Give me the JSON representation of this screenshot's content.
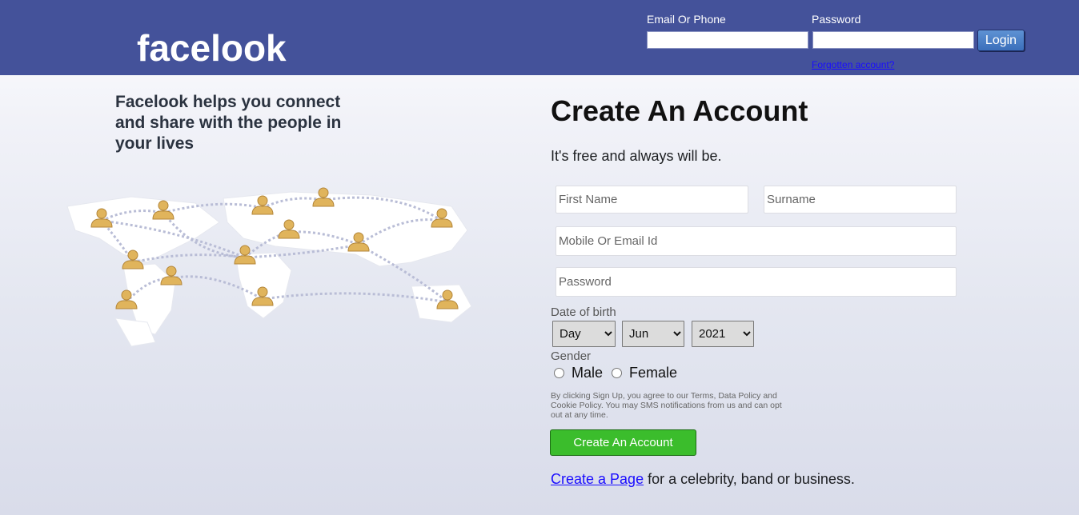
{
  "header": {
    "logo": "facelook",
    "email_label": "Email Or Phone",
    "password_label": "Password",
    "login_button": "Login",
    "forgot_link": "Forgotten account?"
  },
  "intro": {
    "tagline": "Facelook helps you connect and share with the people in your lives",
    "map_icon": "world-map-people-network-icon"
  },
  "signup": {
    "title": "Create An Account",
    "subtitle": "It's free and always will be.",
    "first_name_placeholder": "First Name",
    "surname_placeholder": "Surname",
    "contact_placeholder": "Mobile Or Email Id",
    "password_placeholder": "Password",
    "dob_label": "Date of birth",
    "dob_day": "Day",
    "dob_month": "Jun",
    "dob_year": "2021",
    "gender_label": "Gender",
    "gender_male": "Male",
    "gender_female": "Female",
    "terms": "By clicking Sign Up, you agree to our Terms, Data Policy and Cookie Policy. You may SMS notifications from us and can opt out at any time.",
    "submit_button": "Create An Account",
    "create_page_link": "Create a Page",
    "create_page_rest": " for a celebrity, band or business."
  },
  "colors": {
    "header_bg": "#44529a",
    "login_button": "#4a80c8",
    "signup_button": "#3bbd2c",
    "link": "#1a0dff"
  }
}
